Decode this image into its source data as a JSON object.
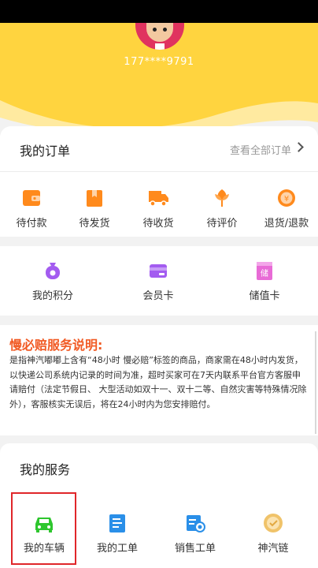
{
  "user": {
    "phone": "177****9791"
  },
  "orders": {
    "title": "我的订单",
    "view_all": "查看全部订单",
    "items": [
      {
        "label": "待付款",
        "icon": "wallet-icon"
      },
      {
        "label": "待发货",
        "icon": "package-icon"
      },
      {
        "label": "待收货",
        "icon": "truck-icon"
      },
      {
        "label": "待评价",
        "icon": "flower-icon"
      },
      {
        "label": "退货/退款",
        "icon": "yuan-coin-icon"
      }
    ]
  },
  "wallet": {
    "items": [
      {
        "label": "我的积分",
        "icon": "points-bag-icon"
      },
      {
        "label": "会员卡",
        "icon": "member-card-icon"
      },
      {
        "label": "储值卡",
        "icon": "stored-value-card-icon",
        "badge": "储"
      }
    ]
  },
  "notice": {
    "title": "慢必赔服务说明:",
    "body": "是指神汽嘟嘟上含有“48小时 慢必赔”标签的商品，商家需在48小时内发货， 以快递公司系统内记录的时间为准，超时买家可在7天内联系平台官方客服申请赔付（法定节假日、 大型活动如双十一、双十二等、自然灾害等特殊情况除外），客服核实无误后，将在24小时内为您安排赔付。"
  },
  "services": {
    "title": "我的服务",
    "items": [
      {
        "label": "我的车辆",
        "icon": "car-icon"
      },
      {
        "label": "我的工单",
        "icon": "work-order-icon"
      },
      {
        "label": "销售工单",
        "icon": "sales-order-icon"
      },
      {
        "label": "神汽链",
        "icon": "chain-coin-icon"
      }
    ]
  },
  "colors": {
    "header": "#ffd43f",
    "order_icon": "#ff8a1c",
    "wallet_icon": "#a35cf0",
    "notice_title": "#f15a24",
    "car_icon": "#2ec62e",
    "service_icon": "#2a8fe8",
    "highlight": "#e0262a"
  }
}
